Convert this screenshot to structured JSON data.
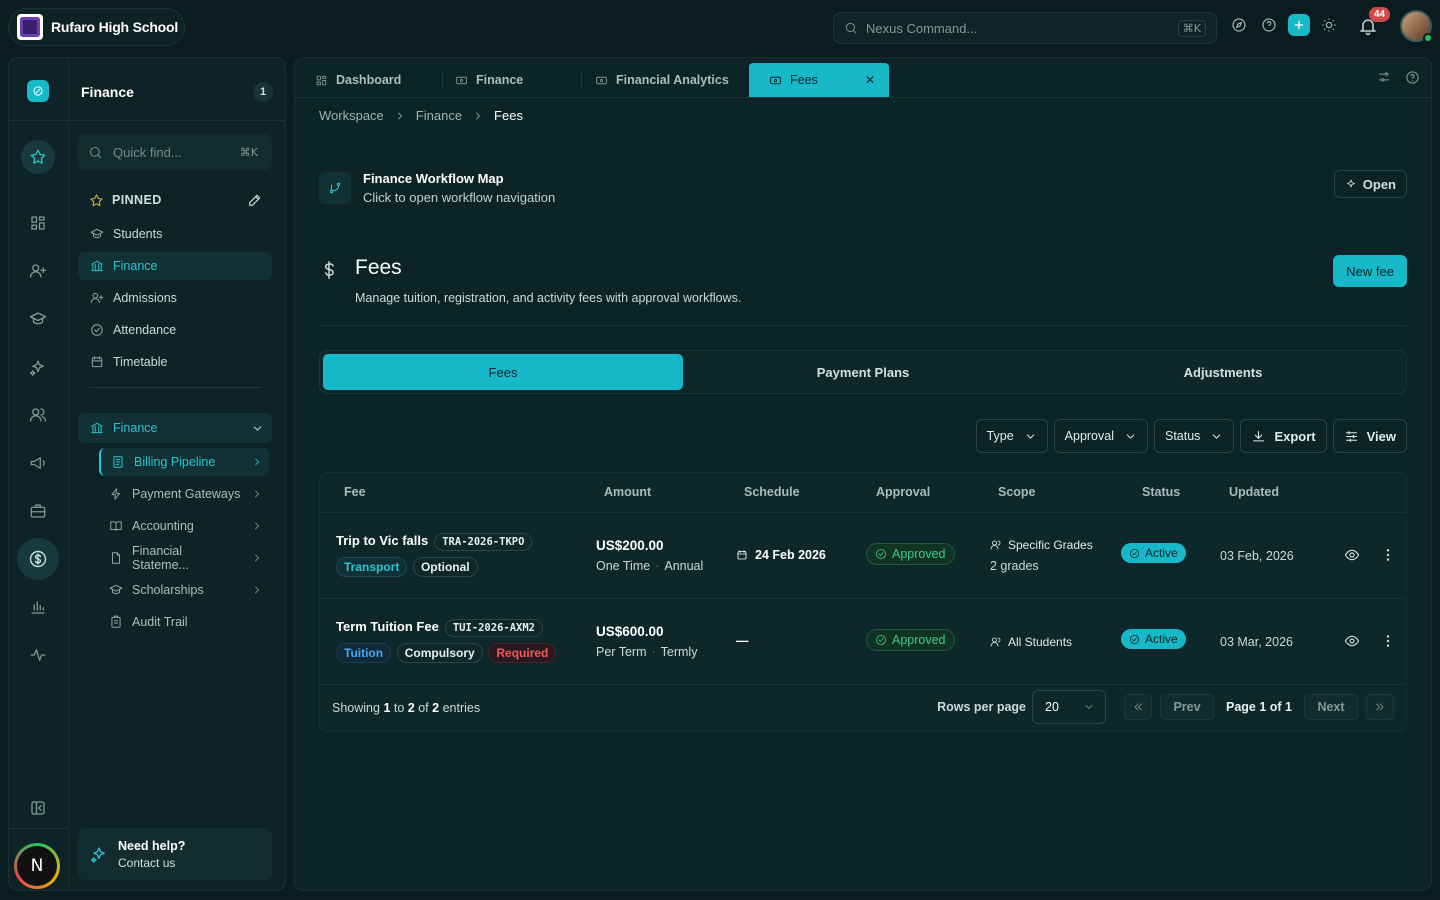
{
  "header": {
    "school_name": "Rufaro High School",
    "command_placeholder": "Nexus Command...",
    "command_shortcut": "⌘K",
    "notification_count": "44"
  },
  "rail": {
    "avatar_initial": "N"
  },
  "sidebar": {
    "title": "Finance",
    "count": "1",
    "quick_find_placeholder": "Quick find...",
    "quick_find_shortcut": "⌘K",
    "pinned_label": "PINNED",
    "pinned": [
      {
        "label": "Students",
        "icon": "graduation-cap-icon"
      },
      {
        "label": "Finance",
        "icon": "bank-icon",
        "active": true
      },
      {
        "label": "Admissions",
        "icon": "user-plus-icon"
      },
      {
        "label": "Attendance",
        "icon": "check-circle-icon"
      },
      {
        "label": "Timetable",
        "icon": "calendar-icon"
      }
    ],
    "group_label": "Finance",
    "sub_items": [
      {
        "label": "Billing Pipeline",
        "icon": "receipt-icon",
        "active": true
      },
      {
        "label": "Payment Gateways",
        "icon": "bolt-icon"
      },
      {
        "label": "Accounting",
        "icon": "book-icon"
      },
      {
        "label": "Financial Stateme...",
        "icon": "document-icon"
      },
      {
        "label": "Scholarships",
        "icon": "graduation-cap-icon"
      },
      {
        "label": "Audit Trail",
        "icon": "clipboard-icon"
      }
    ],
    "help_title": "Need help?",
    "help_subtitle": "Contact us"
  },
  "tabs": [
    {
      "label": "Dashboard",
      "icon": "grid-icon"
    },
    {
      "label": "Finance",
      "icon": "tab-icon"
    },
    {
      "label": "Financial Analytics",
      "icon": "tab-icon"
    },
    {
      "label": "Fees",
      "icon": "tab-icon",
      "active": true
    }
  ],
  "breadcrumb": [
    "Workspace",
    "Finance",
    "Fees"
  ],
  "workflow": {
    "title": "Finance Workflow Map",
    "subtitle": "Click to open workflow navigation",
    "open_label": "Open"
  },
  "page": {
    "title": "Fees",
    "description": "Manage tuition, registration, and activity fees with approval workflows.",
    "new_button": "New fee"
  },
  "segments": [
    "Fees",
    "Payment Plans",
    "Adjustments"
  ],
  "filters": {
    "type": "Type",
    "approval": "Approval",
    "status": "Status",
    "export": "Export",
    "view": "View"
  },
  "table": {
    "columns": [
      "Fee",
      "Amount",
      "Schedule",
      "Approval",
      "Scope",
      "Status",
      "Updated"
    ],
    "rows": [
      {
        "name": "Trip to Vic falls",
        "code": "TRA-2026-TKPO",
        "tags": [
          "Transport",
          "Optional"
        ],
        "amount": "US$200.00",
        "frequency": "One Time",
        "period": "Annual",
        "schedule": "24 Feb 2026",
        "approval": "Approved",
        "scope": "Specific Grades",
        "scope_detail": "2 grades",
        "status": "Active",
        "updated": "03 Feb, 2026"
      },
      {
        "name": "Term Tuition Fee",
        "code": "TUI-2026-AXM2",
        "tags": [
          "Tuition",
          "Compulsory",
          "Required"
        ],
        "amount": "US$600.00",
        "frequency": "Per Term",
        "period": "Termly",
        "schedule": "—",
        "approval": "Approved",
        "scope": "All Students",
        "scope_detail": "",
        "status": "Active",
        "updated": "03 Mar, 2026"
      }
    ],
    "footer": {
      "showing_prefix": "Showing",
      "from": "1",
      "to_word": "to",
      "to": "2",
      "of_word": "of",
      "total": "2",
      "suffix": "entries"
    },
    "pagination": {
      "rows_per_page_label": "Rows per page",
      "rows_per_page": "20",
      "prev": "Prev",
      "page_label": "Page 1 of 1",
      "next": "Next"
    }
  },
  "colors": {
    "accent": "#17b8c8",
    "background": "#0b1c20",
    "approved": "#3ec98a",
    "required": "#ef5a5a"
  }
}
